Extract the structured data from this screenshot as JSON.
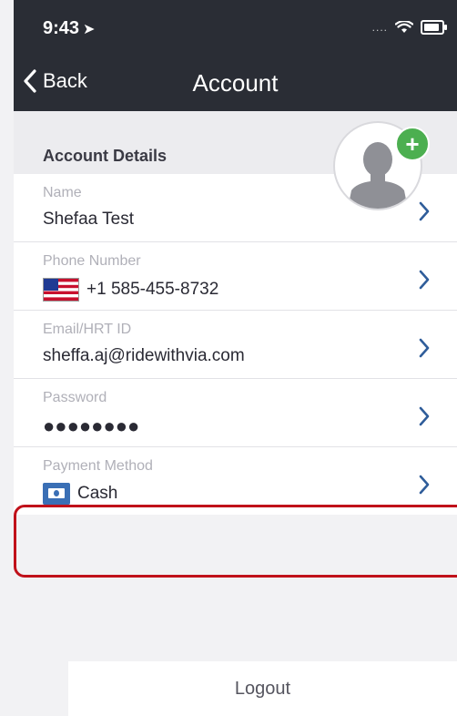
{
  "status_bar": {
    "time": "9:43",
    "location_glyph": "➤",
    "signal": "....",
    "wifi_icon": "wifi-icon",
    "battery_icon": "battery-icon"
  },
  "nav": {
    "back_label": "Back",
    "title": "Account"
  },
  "section": {
    "title": "Account Details"
  },
  "fields": [
    {
      "label": "Name",
      "value": "Shefaa Test"
    },
    {
      "label": "Phone Number",
      "value": "+1 585-455-8732"
    },
    {
      "label": "Email/HRT ID",
      "value": "sheffa.aj@ridewithvia.com"
    },
    {
      "label": "Password",
      "value": "●●●●●●●●"
    },
    {
      "label": "Payment Method",
      "value": "Cash"
    }
  ],
  "logout_label": "Logout",
  "colors": {
    "nav_background": "#2a2d35",
    "accent_green": "#4caf50",
    "chevron_blue": "#2f5d9a",
    "highlight_red": "#c0111a"
  }
}
